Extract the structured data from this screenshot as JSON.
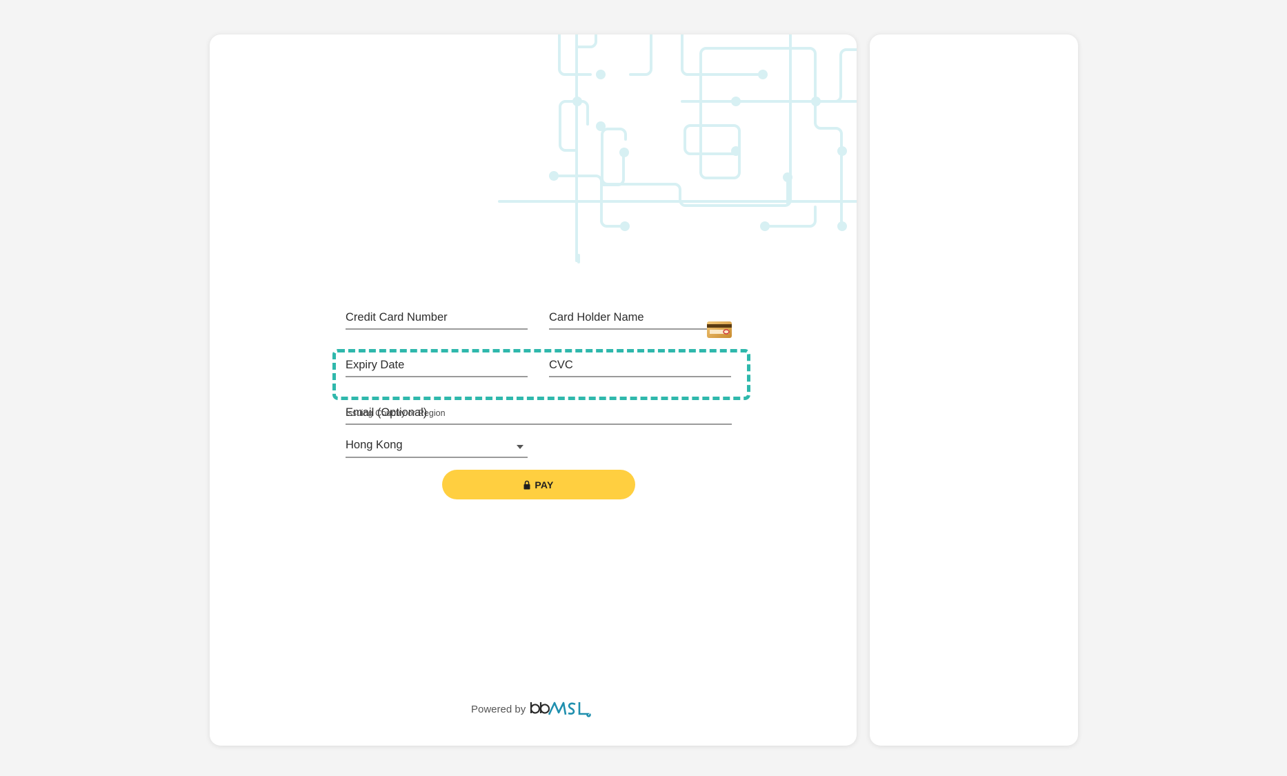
{
  "form": {
    "card_number_label": "Credit Card Number",
    "card_holder_label": "Card Holder Name",
    "expiry_label": "Expiry Date",
    "cvc_label": "CVC",
    "email_label": "Email (Optional)",
    "country_label": "Issuing Country or Region",
    "country_value": "Hong Kong"
  },
  "pay_button": {
    "label": "PAY",
    "icon": "lock-icon",
    "color": "#ffcf40"
  },
  "footer": {
    "powered_by": "Powered by",
    "logo_text": "bbMSL"
  },
  "colors": {
    "highlight": "#2fb8ac",
    "circuit": "#d7f0f3",
    "background": "#f4f4f4"
  }
}
